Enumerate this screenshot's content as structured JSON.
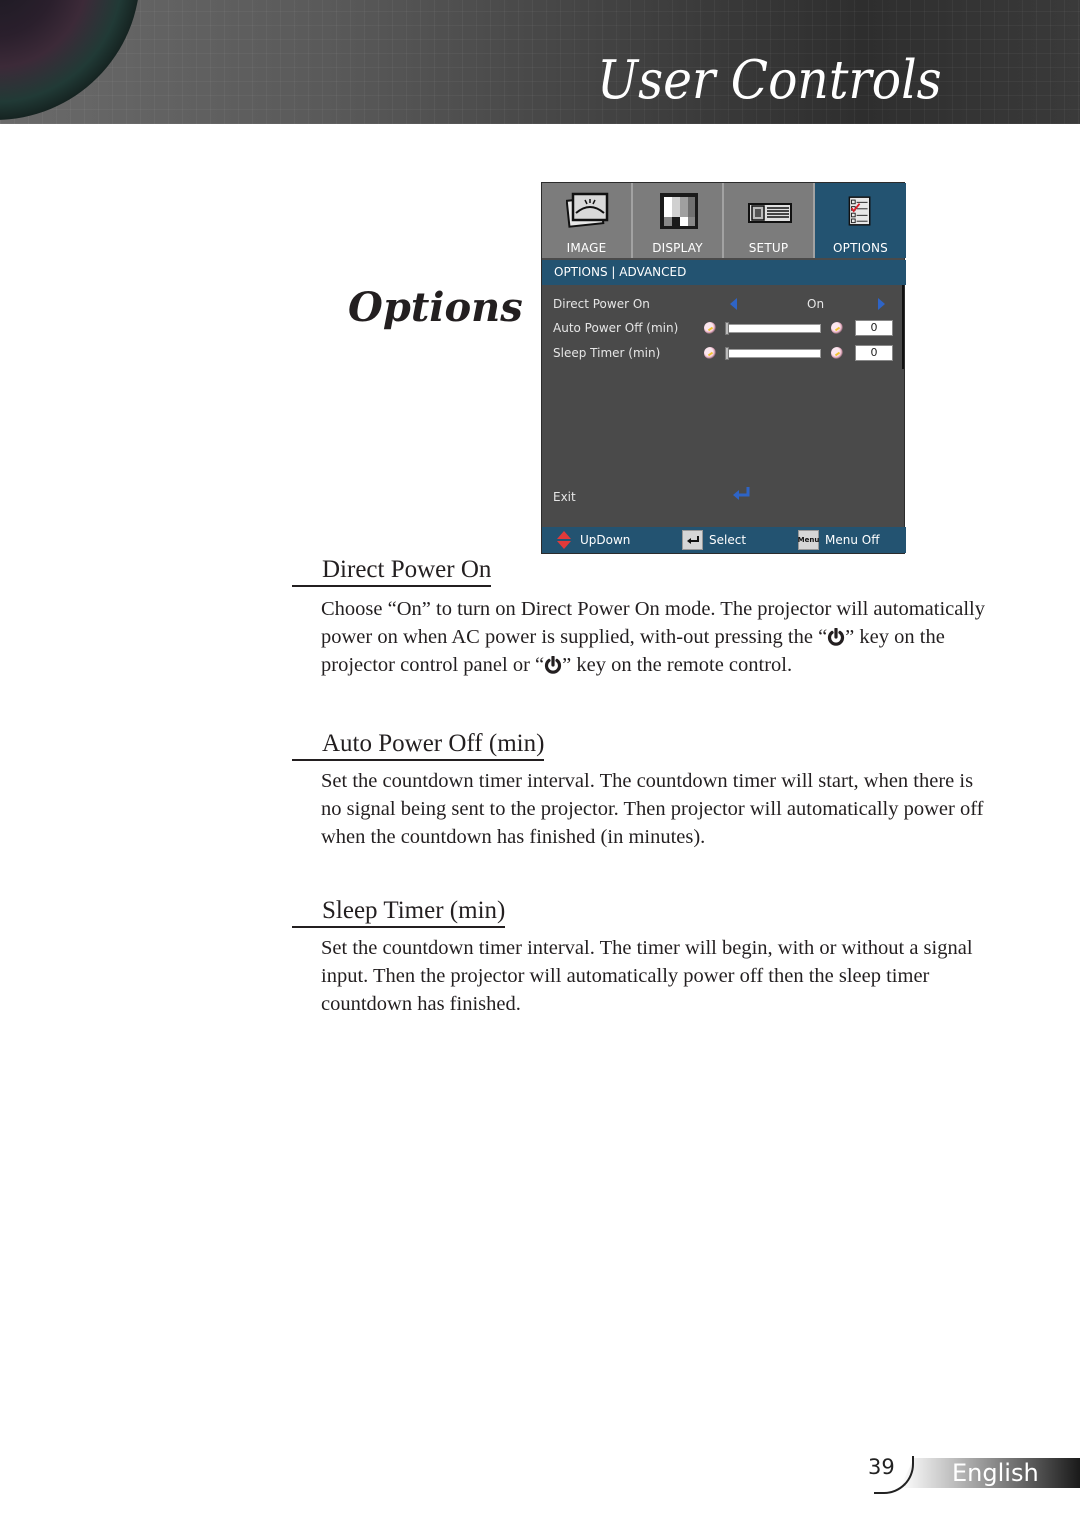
{
  "header": {
    "title": "User Controls"
  },
  "section": {
    "title": "Options"
  },
  "osd": {
    "tabs": [
      {
        "label": "IMAGE",
        "icon": "image-icon",
        "active": false
      },
      {
        "label": "DISPLAY",
        "icon": "display-icon",
        "active": false
      },
      {
        "label": "SETUP",
        "icon": "projector-icon",
        "active": false
      },
      {
        "label": "OPTIONS",
        "icon": "checklist-icon",
        "active": true
      }
    ],
    "breadcrumb": "OPTIONS | ADVANCED",
    "rows": [
      {
        "label": "Direct Power On",
        "value": "On",
        "type": "selector"
      },
      {
        "label": "Auto Power Off (min)",
        "value": "0",
        "type": "slider",
        "level": 0
      },
      {
        "label": "Sleep Timer (min)",
        "value": "0",
        "type": "slider",
        "level": 0
      }
    ],
    "exit_label": "Exit",
    "footer": {
      "updown": "UpDown",
      "select": "Select",
      "menu_key": "Menu",
      "menu_off": "Menu Off"
    },
    "colors": {
      "accent": "#235371",
      "body": "#4a4a4a",
      "tab": "#7c7c7c",
      "arrow": "#2e64c6"
    }
  },
  "sections": [
    {
      "heading": "Direct Power On",
      "paragraph_parts": [
        "Choose “On” to turn on Direct Power On mode. The projector will automatically power on when AC power is supplied, with-out pressing the “",
        "” key on the projector control panel or “",
        "” key on the remote control."
      ]
    },
    {
      "heading": "Auto Power Off (min)",
      "paragraph": "Set the countdown timer interval. The countdown timer will start, when there is no signal being sent to the projector. Then projector will automatically power off when the countdown has finished (in minutes)."
    },
    {
      "heading": "Sleep Timer (min)",
      "paragraph": "Set the countdown timer interval. The timer will begin, with or without a signal input. Then the projector will automatically power off then the sleep timer countdown has finished."
    }
  ],
  "footer": {
    "page_number": "39",
    "language": "English"
  }
}
